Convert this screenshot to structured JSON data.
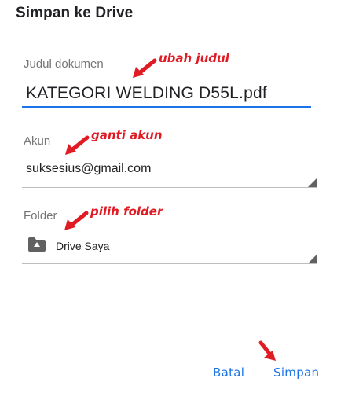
{
  "dialog": {
    "title": "Simpan ke Drive"
  },
  "document": {
    "label": "Judul dokumen",
    "value": "KATEGORI WELDING D55L.pdf",
    "annotation": "ubah judul"
  },
  "account": {
    "label": "Akun",
    "value": "suksesius@gmail.com",
    "annotation": "ganti akun"
  },
  "folder": {
    "label": "Folder",
    "value": "Drive Saya",
    "icon": "drive-folder-icon",
    "annotation": "pilih folder"
  },
  "buttons": {
    "cancel": "Batal",
    "save": "Simpan"
  },
  "colors": {
    "accent": "#1a73e8",
    "annotation": "#e01b24"
  }
}
